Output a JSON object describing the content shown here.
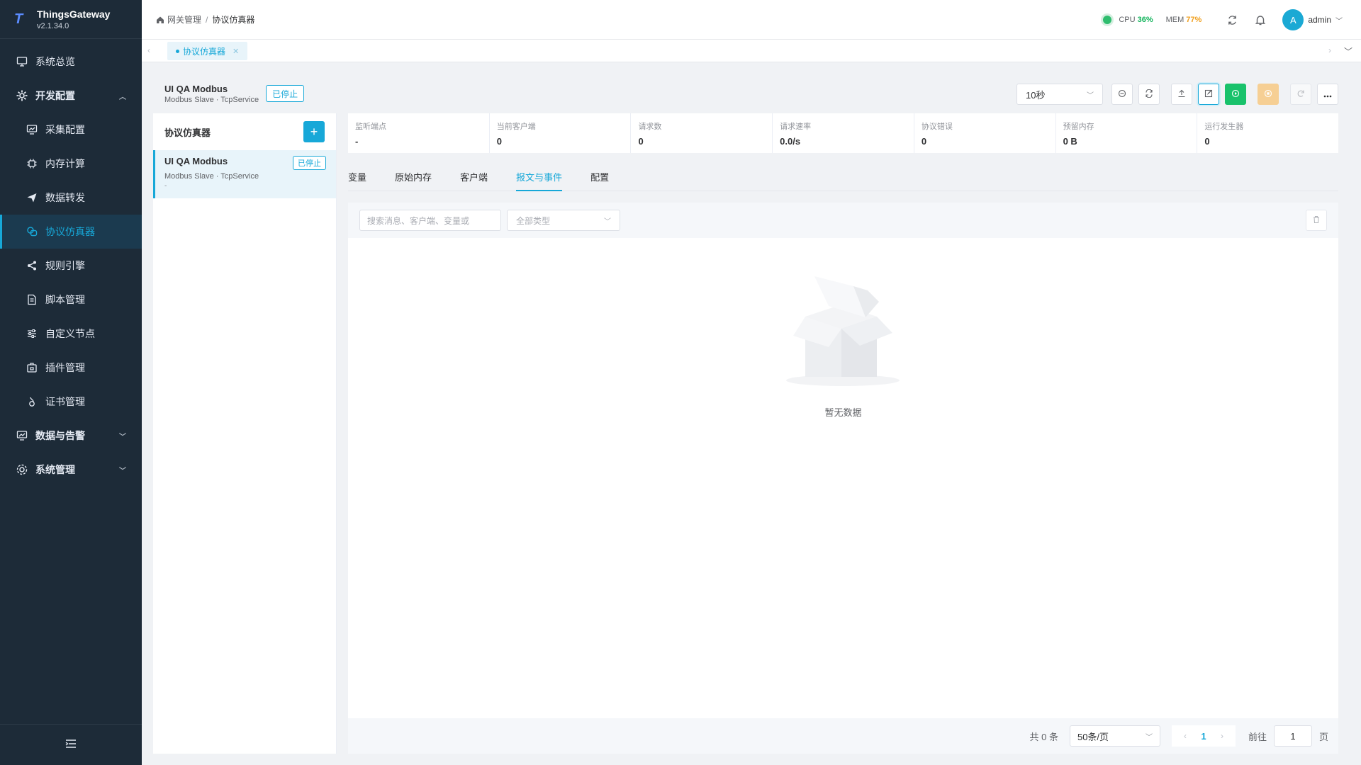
{
  "app": {
    "name": "ThingsGateway",
    "version": "v2.1.34.0",
    "logo_letter": "T"
  },
  "sidebar": {
    "items": [
      {
        "label": "系统总览",
        "icon": "monitor-icon",
        "level": "top"
      },
      {
        "label": "开发配置",
        "icon": "gear-icon",
        "level": "parent",
        "expanded": true
      },
      {
        "label": "采集配置",
        "icon": "chart-icon",
        "level": "child"
      },
      {
        "label": "内存计算",
        "icon": "chip-icon",
        "level": "child"
      },
      {
        "label": "数据转发",
        "icon": "send-icon",
        "level": "child"
      },
      {
        "label": "协议仿真器",
        "icon": "simulator-icon",
        "level": "child",
        "active": true
      },
      {
        "label": "规则引擎",
        "icon": "share-icon",
        "level": "child"
      },
      {
        "label": "脚本管理",
        "icon": "document-icon",
        "level": "child"
      },
      {
        "label": "自定义节点",
        "icon": "sliders-icon",
        "level": "child"
      },
      {
        "label": "插件管理",
        "icon": "plugin-icon",
        "level": "child"
      },
      {
        "label": "证书管理",
        "icon": "certificate-icon",
        "level": "child"
      },
      {
        "label": "数据与告警",
        "icon": "monitor-icon",
        "level": "parent",
        "expanded": false
      },
      {
        "label": "系统管理",
        "icon": "gear-icon",
        "level": "parent",
        "expanded": false
      }
    ]
  },
  "header": {
    "breadcrumb": {
      "root": "网关管理",
      "separator": "/",
      "current": "协议仿真器"
    },
    "cpu_label": "CPU",
    "cpu_value": "36%",
    "mem_label": "MEM",
    "mem_value": "77%",
    "avatar_letter": "A",
    "user": "admin"
  },
  "tabbar": {
    "tabs": [
      {
        "label": "协议仿真器",
        "active": true
      }
    ]
  },
  "simulator": {
    "title": "UI QA Modbus",
    "subtitle": "Modbus Slave · TcpService",
    "status": "已停止",
    "interval": "10秒"
  },
  "list_panel": {
    "title": "协议仿真器",
    "add_label": "+",
    "items": [
      {
        "title": "UI QA Modbus",
        "subtitle": "Modbus Slave · TcpService",
        "detail": "-",
        "status": "已停止"
      }
    ]
  },
  "stats": [
    {
      "label": "监听端点",
      "value": "-"
    },
    {
      "label": "当前客户端",
      "value": "0"
    },
    {
      "label": "请求数",
      "value": "0"
    },
    {
      "label": "请求速率",
      "value": "0.0/s"
    },
    {
      "label": "协议错误",
      "value": "0"
    },
    {
      "label": "预留内存",
      "value": "0 B"
    },
    {
      "label": "运行发生器",
      "value": "0"
    }
  ],
  "tabs": [
    {
      "label": "变量"
    },
    {
      "label": "原始内存"
    },
    {
      "label": "客户端"
    },
    {
      "label": "报文与事件",
      "active": true
    },
    {
      "label": "配置"
    }
  ],
  "filter": {
    "search_placeholder": "搜索消息、客户端、变量或",
    "type_placeholder": "全部类型"
  },
  "empty_text": "暂无数据",
  "pager": {
    "total": "共 0 条",
    "page_size": "50条/页",
    "current_page": "1",
    "goto_label": "前往",
    "goto_value": "1",
    "page_suffix": "页"
  },
  "colors": {
    "accent": "#17a8d8",
    "sidebar_bg": "#1d2b38",
    "run": "#19c26b",
    "stop": "#f6cf94",
    "cpu": "#13b45c",
    "mem": "#f0a020"
  }
}
